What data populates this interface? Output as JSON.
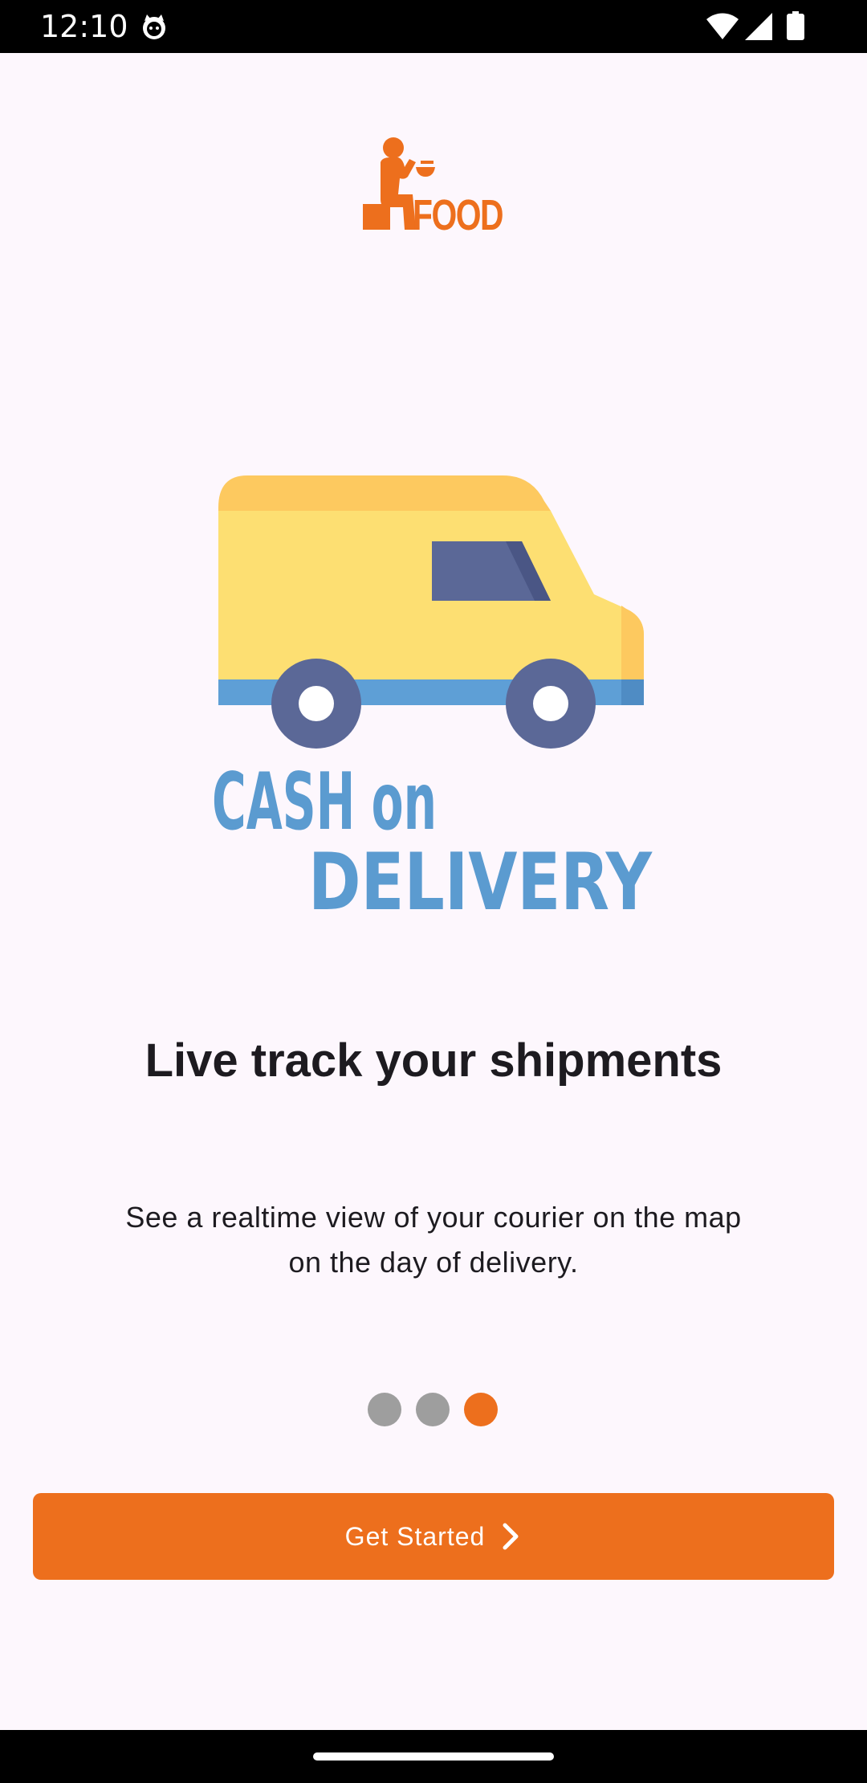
{
  "status_bar": {
    "time": "12:10",
    "icons": [
      "cat-notification-icon",
      "wifi-icon",
      "signal-icon",
      "battery-icon"
    ]
  },
  "logo": {
    "text": "FOOD",
    "color": "#ed6f1d"
  },
  "illustration": {
    "line1": "CASH on",
    "line2": "DELIVERY",
    "text_color": "#5b9bd0",
    "van_body_color": "#fddf72",
    "van_roof_color": "#fdc95f",
    "window_color": "#5b6897",
    "wheel_color": "#5b6897",
    "bumper_color": "#5e9fd6"
  },
  "onboarding": {
    "title": "Live track your shipments",
    "description": "See a realtime view of your courier on the map on the day of delivery.",
    "page_count": 3,
    "active_page": 3
  },
  "cta": {
    "label": "Get Started",
    "icon": "chevron-right-icon",
    "color": "#ed6f1d"
  },
  "colors": {
    "background": "#fdf7fd",
    "accent": "#ed6f1d",
    "inactive_dot": "#9e9e9e"
  }
}
